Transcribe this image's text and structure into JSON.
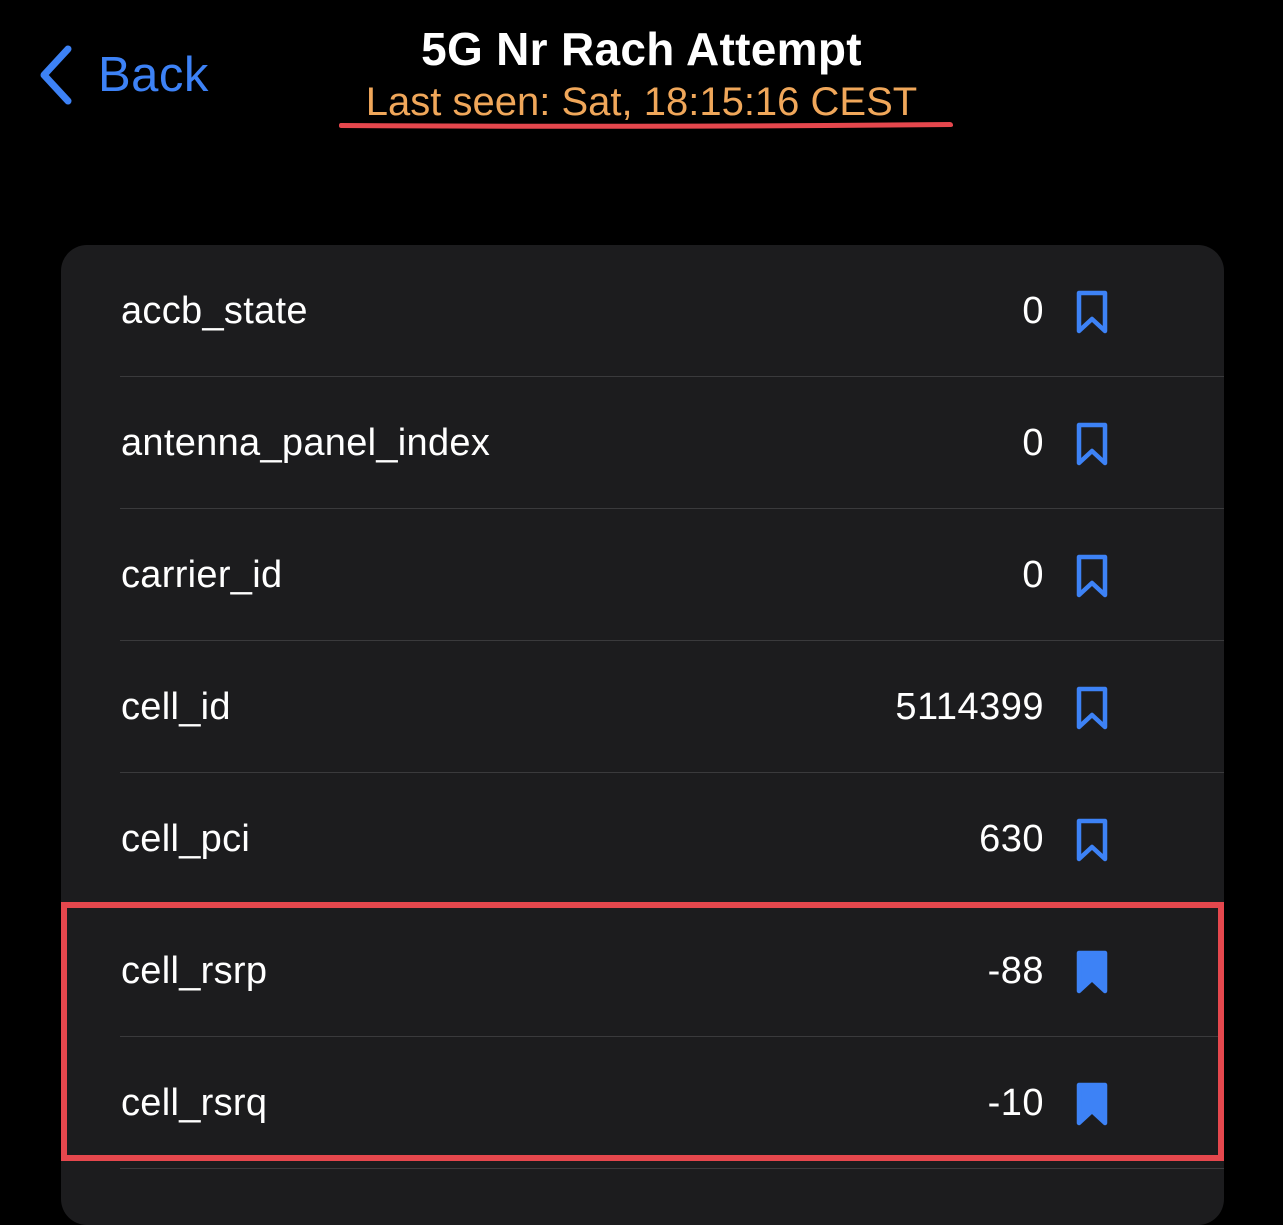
{
  "nav": {
    "back_label": "Back",
    "title": "5G Nr Rach Attempt",
    "subtitle": "Last seen: Sat, 18:15:16 CEST"
  },
  "colors": {
    "background": "#000000",
    "card": "#1c1c1e",
    "accent_blue": "#3d82f6",
    "subtitle_orange": "#f0a75a",
    "annotation_red": "#e5474d"
  },
  "rows": [
    {
      "key": "accb_state",
      "value": "0",
      "bookmarked": false
    },
    {
      "key": "antenna_panel_index",
      "value": "0",
      "bookmarked": false
    },
    {
      "key": "carrier_id",
      "value": "0",
      "bookmarked": false
    },
    {
      "key": "cell_id",
      "value": "5114399",
      "bookmarked": false
    },
    {
      "key": "cell_pci",
      "value": "630",
      "bookmarked": false
    },
    {
      "key": "cell_rsrp",
      "value": "-88",
      "bookmarked": true
    },
    {
      "key": "cell_rsrq",
      "value": "-10",
      "bookmarked": true
    }
  ],
  "icons": {
    "back": "chevron-left-icon",
    "bookmark_outline": "bookmark-outline-icon",
    "bookmark_filled": "bookmark-filled-icon"
  }
}
